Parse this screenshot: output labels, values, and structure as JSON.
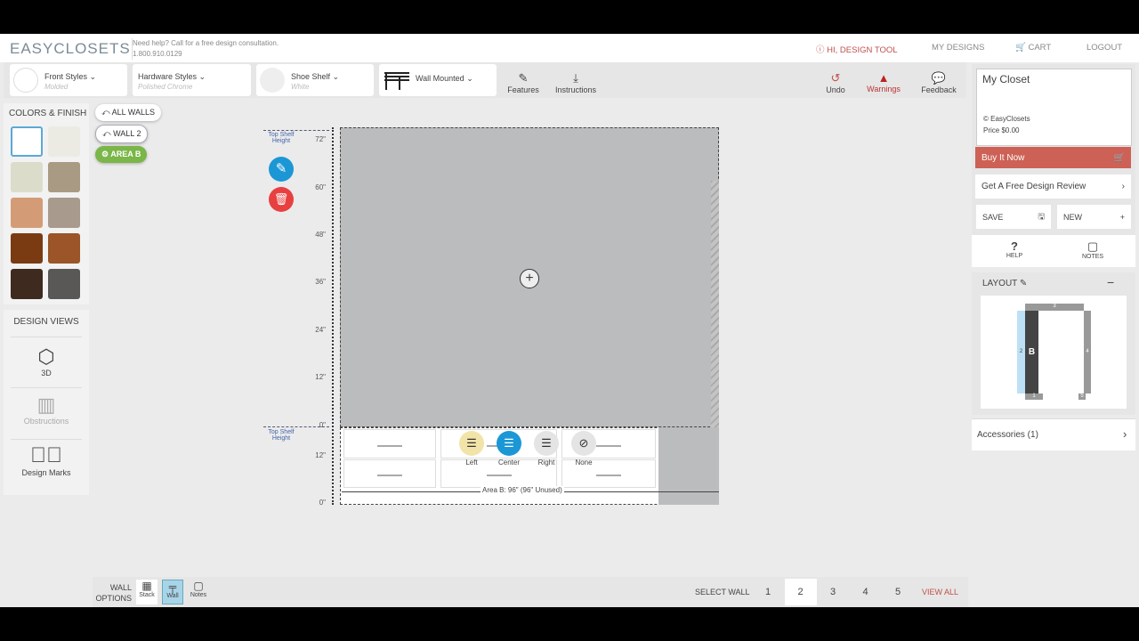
{
  "header": {
    "logo": "EASYCLOSETS",
    "help_line": "Need help? Call for a free design consultation.",
    "phone": "1.800.910.0129",
    "user": "HI, DESIGN TOOL",
    "my_designs": "MY DESIGNS",
    "cart": "CART",
    "logout": "LOGOUT"
  },
  "toolbar": {
    "front_styles": {
      "label": "Front Styles",
      "value": "Molded"
    },
    "hardware_styles": {
      "label": "Hardware Styles",
      "value": "Polished Chrome"
    },
    "shoe_shelf": {
      "label": "Shoe Shelf",
      "value": "White"
    },
    "mount": {
      "label": "Wall Mounted"
    },
    "features": "Features",
    "instructions": "Instructions",
    "undo": "Undo",
    "warnings": "Warnings",
    "feedback": "Feedback"
  },
  "left": {
    "colors_title": "COLORS & FINISH",
    "swatches": [
      "#ffffff",
      "#ecebe3",
      "#dcdccb",
      "#a99a84",
      "#d49c76",
      "#a89a8c",
      "#7b3b12",
      "#9b5528",
      "#3f2a1f",
      "#5a5857"
    ],
    "design_views_title": "DESIGN VIEWS",
    "views": [
      "3D",
      "Obstructions",
      "Design Marks"
    ]
  },
  "breadcrumbs": {
    "all_walls": "ALL WALLS",
    "wall": "WALL 2",
    "area": "AREA B"
  },
  "canvas": {
    "top_shelf_label": "Top Shelf Height",
    "ruler_upper": [
      "72\"",
      "60\"",
      "48\"",
      "36\"",
      "24\"",
      "12\"",
      "0\""
    ],
    "ruler_lower": [
      "12\"",
      "0\""
    ],
    "area_label": "Area B: 96\" (96\" Unused)",
    "align_options": [
      "Left",
      "Center",
      "Right",
      "None"
    ],
    "selected_align": "Center"
  },
  "bottom": {
    "wall_options": "WALL OPTIONS",
    "stack": "Stack",
    "wall": "Wall",
    "notes": "Notes",
    "select_wall": "SELECT WALL",
    "walls": [
      "1",
      "2",
      "3",
      "4",
      "5"
    ],
    "selected_wall": "2",
    "view_all": "VIEW ALL"
  },
  "right": {
    "closet_name": "My Closet",
    "copyright": "© EasyClosets",
    "price": "Price $0.00",
    "buy": "Buy It Now",
    "review": "Get A Free Design Review",
    "save": "SAVE",
    "new": "NEW",
    "help": "HELP",
    "notes": "NOTES",
    "layout": "LAYOUT",
    "layout_area": "B",
    "layout_walls": [
      "1",
      "2",
      "3",
      "4",
      "5"
    ],
    "accessories": "Accessories (1)"
  }
}
